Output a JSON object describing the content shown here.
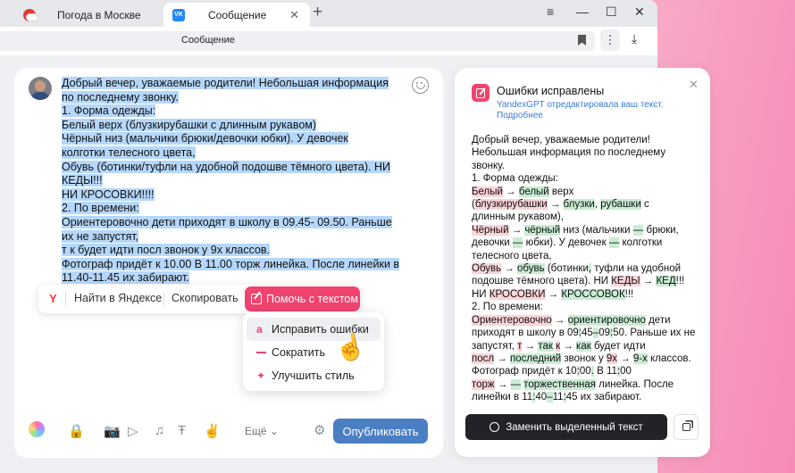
{
  "browser": {
    "tabs": [
      {
        "label": "Погода в Москве"
      },
      {
        "label": "Сообщение"
      }
    ],
    "new_tab": "+",
    "address": "Сообщение",
    "window_controls": {
      "menu": "≡",
      "minimize": "—",
      "maximize": "☐",
      "close": "✕"
    }
  },
  "message": {
    "lines": [
      "Добрый вечер, уважаемые родители! Небольшая информация",
      "по последнему звонку.",
      "1. Форма одежды:",
      "Белый верх (блузкирубашки с длинным рукавом)",
      "Чёрный низ (мальчики брюки/девочки юбки). У девочек",
      "колготки телесного цвета,",
      "Обувь (ботинки/туфли на удобной подошве тёмного цвета). НИ",
      "КЕДЫ!!!",
      "НИ КРОСОВКИ!!!! ",
      "2. По времени:",
      "Ориентеровочно дети приходят в школу в 09.45- 09.50. Раньше",
      "их не запустят,",
      "т к будет идти посл звонок у 9х классов.",
      "Фотограф придёт к 10.00 В 11.00 торж линейка. После линейки в",
      "11.40-11.45 их забирают."
    ]
  },
  "context_menu": {
    "logo": "Y",
    "find": "Найти в Яндексе",
    "copy": "Скопировать",
    "help": "Помочь с текстом"
  },
  "submenu": {
    "items": [
      {
        "icon": "a",
        "label": "Исправить ошибки"
      },
      {
        "icon": "",
        "label": "Сократить"
      },
      {
        "icon": "✦",
        "label": "Улучшить стиль"
      }
    ]
  },
  "toolbar": {
    "more": "Ещё",
    "publish": "Опубликовать"
  },
  "panel": {
    "title": "Ошибки исправлены",
    "subtitle": "YandexGPT отредактировала ваш текст.",
    "more_link": "Подробнее",
    "replace_button": "Заменить выделенный текст",
    "lines": [
      [
        {
          "t": "Добрый вечер, уважаемые родители!"
        }
      ],
      [
        {
          "t": "Небольшая информация по последнему"
        }
      ],
      [
        {
          "t": "звонку."
        }
      ],
      [
        {
          "t": "1. Форма одежды:"
        }
      ],
      [
        {
          "t": "Белый",
          "c": "del"
        },
        {
          "t": " → "
        },
        {
          "t": "белый",
          "c": "ins"
        },
        {
          "t": " верх"
        }
      ],
      [
        {
          "t": "("
        },
        {
          "t": "блузкирубашки",
          "c": "del"
        },
        {
          "t": " → "
        },
        {
          "t": "блузки",
          "c": "ins"
        },
        {
          "t": ", "
        },
        {
          "t": "рубашки",
          "c": "ins"
        },
        {
          "t": " с"
        }
      ],
      [
        {
          "t": "длинным рукавом),"
        }
      ],
      [
        {
          "t": "Чёрный",
          "c": "del"
        },
        {
          "t": " → "
        },
        {
          "t": "чёрный",
          "c": "ins"
        },
        {
          "t": " низ (мальчики "
        },
        {
          "t": "—",
          "c": "ins"
        },
        {
          "t": " брюки,"
        }
      ],
      [
        {
          "t": "девочки "
        },
        {
          "t": "—",
          "c": "ins"
        },
        {
          "t": " юбки). У девочек "
        },
        {
          "t": "—",
          "c": "ins"
        },
        {
          "t": " колготки"
        }
      ],
      [
        {
          "t": "телесного цвета,"
        }
      ],
      [
        {
          "t": "Обувь",
          "c": "del"
        },
        {
          "t": " → "
        },
        {
          "t": "обувь",
          "c": "ins"
        },
        {
          "t": " (ботинки"
        },
        {
          "t": ",",
          "c": "ins"
        },
        {
          "t": " туфли на удобной"
        }
      ],
      [
        {
          "t": "подошве тёмного цвета). НИ "
        },
        {
          "t": "КЕДЫ",
          "c": "del"
        },
        {
          "t": " → "
        },
        {
          "t": "КЕД",
          "c": "ins"
        },
        {
          "t": "!!!"
        }
      ],
      [
        {
          "t": "НИ "
        },
        {
          "t": "КРОСОВКИ",
          "c": "del"
        },
        {
          "t": " → "
        },
        {
          "t": "КРОССОВОК",
          "c": "ins"
        },
        {
          "t": "!!!"
        }
      ],
      [
        {
          "t": "2. По времени:"
        }
      ],
      [
        {
          "t": "Ориентеровочно",
          "c": "del"
        },
        {
          "t": " → "
        },
        {
          "t": "ориентировочно",
          "c": "ins"
        },
        {
          "t": " дети"
        }
      ],
      [
        {
          "t": "приходят в школу в 09"
        },
        {
          "t": ":",
          "c": "ins"
        },
        {
          "t": "45"
        },
        {
          "t": "–",
          "c": "ins"
        },
        {
          "t": "09"
        },
        {
          "t": ":",
          "c": "ins"
        },
        {
          "t": "50. Раньше их не"
        }
      ],
      [
        {
          "t": "запустят, "
        },
        {
          "t": "т",
          "c": "del"
        },
        {
          "t": " → "
        },
        {
          "t": "так",
          "c": "ins"
        },
        {
          "t": " "
        },
        {
          "t": "к",
          "c": "del"
        },
        {
          "t": " → "
        },
        {
          "t": "как",
          "c": "ins"
        },
        {
          "t": " будет идти"
        }
      ],
      [
        {
          "t": "посл",
          "c": "del"
        },
        {
          "t": " → "
        },
        {
          "t": "последний",
          "c": "ins"
        },
        {
          "t": " звонок у "
        },
        {
          "t": "9х",
          "c": "del"
        },
        {
          "t": " → "
        },
        {
          "t": "9-х",
          "c": "ins"
        },
        {
          "t": " классов."
        }
      ],
      [
        {
          "t": "Фотограф придёт к 10"
        },
        {
          "t": ":",
          "c": "ins"
        },
        {
          "t": "00"
        },
        {
          "t": ".",
          "c": "ins"
        },
        {
          "t": " В 11"
        },
        {
          "t": ":",
          "c": "ins"
        },
        {
          "t": "00"
        }
      ],
      [
        {
          "t": "торж",
          "c": "del"
        },
        {
          "t": " → "
        },
        {
          "t": "—",
          "c": "ins"
        },
        {
          "t": " "
        },
        {
          "t": "торжественная",
          "c": "ins"
        },
        {
          "t": " линейка. После"
        }
      ],
      [
        {
          "t": "линейки в 11"
        },
        {
          "t": ":",
          "c": "ins"
        },
        {
          "t": "40"
        },
        {
          "t": "–",
          "c": "ins"
        },
        {
          "t": "11"
        },
        {
          "t": ":",
          "c": "ins"
        },
        {
          "t": "45 их забирают."
        }
      ]
    ]
  }
}
